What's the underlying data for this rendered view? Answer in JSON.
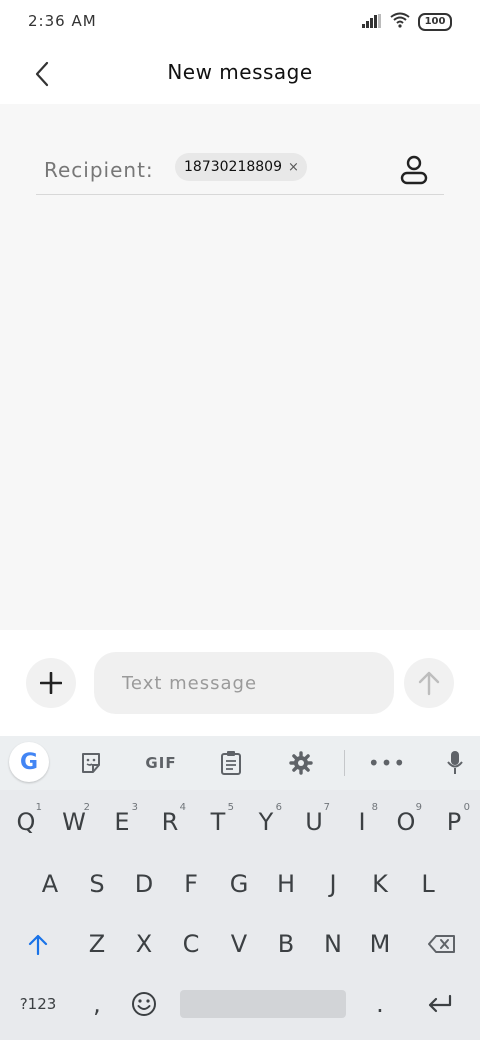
{
  "status": {
    "time": "2:36 AM",
    "battery": "100"
  },
  "header": {
    "title": "New message"
  },
  "recipient": {
    "label": "Recipient:",
    "chip": "18730218809",
    "chip_remove": "×"
  },
  "composer": {
    "placeholder": "Text message"
  },
  "keyboard": {
    "toolbar": {
      "google": "G",
      "gif": "GIF",
      "more": "•••"
    },
    "row1": [
      {
        "key": "Q",
        "hint": "1"
      },
      {
        "key": "W",
        "hint": "2"
      },
      {
        "key": "E",
        "hint": "3"
      },
      {
        "key": "R",
        "hint": "4"
      },
      {
        "key": "T",
        "hint": "5"
      },
      {
        "key": "Y",
        "hint": "6"
      },
      {
        "key": "U",
        "hint": "7"
      },
      {
        "key": "I",
        "hint": "8"
      },
      {
        "key": "O",
        "hint": "9"
      },
      {
        "key": "P",
        "hint": "0"
      }
    ],
    "row2": [
      "A",
      "S",
      "D",
      "F",
      "G",
      "H",
      "J",
      "K",
      "L"
    ],
    "row3": [
      "Z",
      "X",
      "C",
      "V",
      "B",
      "N",
      "M"
    ],
    "row4": {
      "symbols": "?123",
      "comma": ",",
      "period": "."
    }
  },
  "colors": {
    "accent": "#4285F4",
    "shift": "#1a73e8"
  }
}
